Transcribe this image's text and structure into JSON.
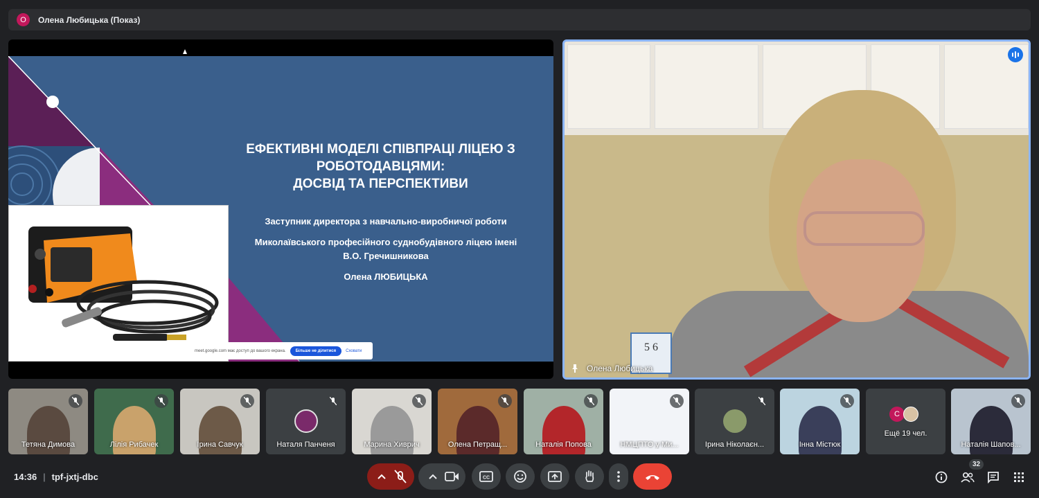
{
  "presenter_bar": {
    "avatar_letter": "О",
    "title": "Олена Любицька (Показ)"
  },
  "slide": {
    "title_line1": "ЕФЕКТИВНІ МОДЕЛІ СПІВПРАЦІ ЛІЦЕЮ З",
    "title_line2": "РОБОТОДАВЦЯМИ:",
    "title_line3": "ДОСВІД ТА ПЕРСПЕКТИВИ",
    "subtitle1": "Заступник директора з навчально-виробничої роботи",
    "subtitle2": "Миколаївського професійного суднобудівного ліцею імені",
    "subtitle3": "В.О. Гречишникова",
    "author": "Олена ЛЮБИЦЬКА"
  },
  "share_banner": {
    "text": "meet.google.com має доступ до вашого екрана.",
    "stop_label": "Більше не ділитися",
    "hide_label": "Сховати"
  },
  "speaker": {
    "name": "Олена Любицька",
    "board_text": "5 6"
  },
  "participants": [
    {
      "name": "Тетяна Димова"
    },
    {
      "name": "Лілія Рибачек"
    },
    {
      "name": "Ірина Савчук"
    },
    {
      "name": "Наталя Панченя"
    },
    {
      "name": "Марина Хиврич"
    },
    {
      "name": "Олена Петращ..."
    },
    {
      "name": "Наталія Попова"
    },
    {
      "name": "НМЦПТО у Ми..."
    },
    {
      "name": "Ірина Ніколаєн..."
    },
    {
      "name": "Інна Містюк"
    },
    {
      "name": "Ещё 19 чел.",
      "avatar_letter": "С"
    },
    {
      "name": "Наталія Шапов..."
    }
  ],
  "bottom_bar": {
    "time": "14:36",
    "meeting_code": "tpf-jxtj-dbc",
    "participants_count": "32"
  },
  "colors": {
    "background": "#202124",
    "slide_blue": "#3a5f8c",
    "accent_purple": "#8b2d7e",
    "end_call": "#ea4335",
    "active_border": "#8ab4f8"
  }
}
